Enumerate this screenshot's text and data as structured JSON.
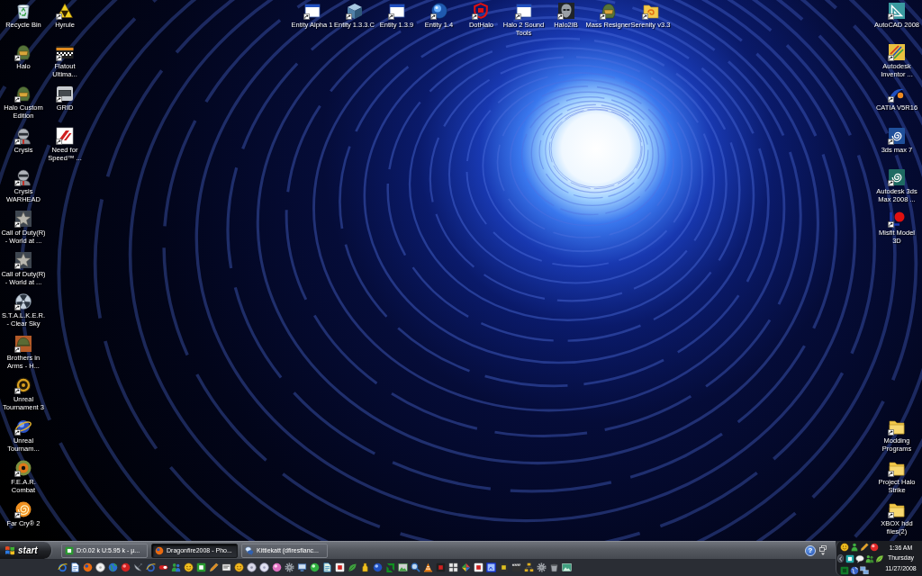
{
  "desktop": {
    "left_column": [
      {
        "label": "Recycle Bin",
        "kind": "recycle-bin",
        "shortcut": false
      },
      {
        "label": "Halo",
        "kind": "helmet",
        "shortcut": true
      },
      {
        "label": "Halo Custom Edition",
        "kind": "helmet",
        "shortcut": true
      },
      {
        "label": "Crysis",
        "kind": "armor",
        "shortcut": true
      },
      {
        "label": "Crysis WARHEAD",
        "kind": "armor",
        "shortcut": true
      },
      {
        "label": "Call of Duty(R) - World at ...",
        "kind": "star",
        "shortcut": true
      },
      {
        "label": "Call of Duty(R) - World at ...",
        "kind": "star",
        "shortcut": true
      },
      {
        "label": "S.T.A.L.K.E.R. - Clear Sky",
        "kind": "trefoil",
        "shortcut": true
      },
      {
        "label": "Brothers in Arms - H...",
        "kind": "helmet-tile",
        "shortcut": true
      },
      {
        "label": "Unreal Tournament 3",
        "kind": "ring",
        "shortcut": true
      },
      {
        "label": "Unreal Tournam...",
        "kind": "orbit",
        "shortcut": true
      },
      {
        "label": "F.E.A.R. Combat",
        "kind": "eye",
        "shortcut": true
      },
      {
        "label": "Far Cry® 2",
        "kind": "spiral",
        "shortcut": true
      }
    ],
    "second_column": [
      {
        "label": "Hyrule",
        "kind": "triangle",
        "shortcut": true
      },
      {
        "label": "Flatout Ultima...",
        "kind": "checkered",
        "shortcut": true
      },
      {
        "label": "GRID",
        "kind": "grille",
        "shortcut": true
      },
      {
        "label": "Need for Speed™ ...",
        "kind": "slash",
        "shortcut": true
      }
    ],
    "top_row": [
      {
        "label": "Entity Alpha 1",
        "kind": "window",
        "shortcut": true
      },
      {
        "label": "Entity 1.3.3.C",
        "kind": "cube",
        "shortcut": true
      },
      {
        "label": "Entity 1.3.9",
        "kind": "window",
        "shortcut": true
      },
      {
        "label": "Entity 1.4",
        "kind": "orb",
        "shortcut": true
      },
      {
        "label": "DotHalo",
        "kind": "angular",
        "shortcut": true
      },
      {
        "label": "Halo 2 Sound Tools",
        "kind": "window",
        "shortcut": true
      },
      {
        "label": "Halo2IB",
        "kind": "mask",
        "shortcut": true
      },
      {
        "label": "Mass Resigner",
        "kind": "helmet",
        "shortcut": true
      },
      {
        "label": "Serenity v3.3",
        "kind": "swirl-folder",
        "shortcut": true
      }
    ],
    "right_column_top": [
      {
        "label": "AutoCAD 2008",
        "kind": "drafting",
        "shortcut": true
      },
      {
        "label": "Autodesk Inventor ...",
        "kind": "pencils",
        "shortcut": true
      },
      {
        "label": "CATIA V5R16",
        "kind": "swoosh",
        "shortcut": true
      },
      {
        "label": "3ds max 7",
        "kind": "spiral-tile",
        "shortcut": true
      },
      {
        "label": "Autodesk 3ds Max 2008 ...",
        "kind": "spiral-tile-dark",
        "shortcut": true
      },
      {
        "label": "Misfit Model 3D",
        "kind": "ball",
        "shortcut": true
      }
    ],
    "right_column_bottom": [
      {
        "label": "Modding Programs",
        "kind": "folder",
        "shortcut": true
      },
      {
        "label": "Project Halo Strike",
        "kind": "folder",
        "shortcut": true
      },
      {
        "label": "XBOX hdd files(2)",
        "kind": "folder",
        "shortcut": true
      }
    ]
  },
  "taskbar": {
    "start_button": "start",
    "tasks": [
      {
        "label": "D:0.02 k U:5.95 k - µ...",
        "kind": "torrent",
        "selected": false
      },
      {
        "label": "Dragonfire2008 - Pho...",
        "kind": "browser",
        "selected": true
      },
      {
        "label": "Kittiekatt (dfiresflanc...",
        "kind": "chat",
        "selected": false
      }
    ],
    "help_button": "?",
    "clock": {
      "time": "1:36 AM",
      "day": "Thursday",
      "date": "11/27/2008"
    }
  }
}
